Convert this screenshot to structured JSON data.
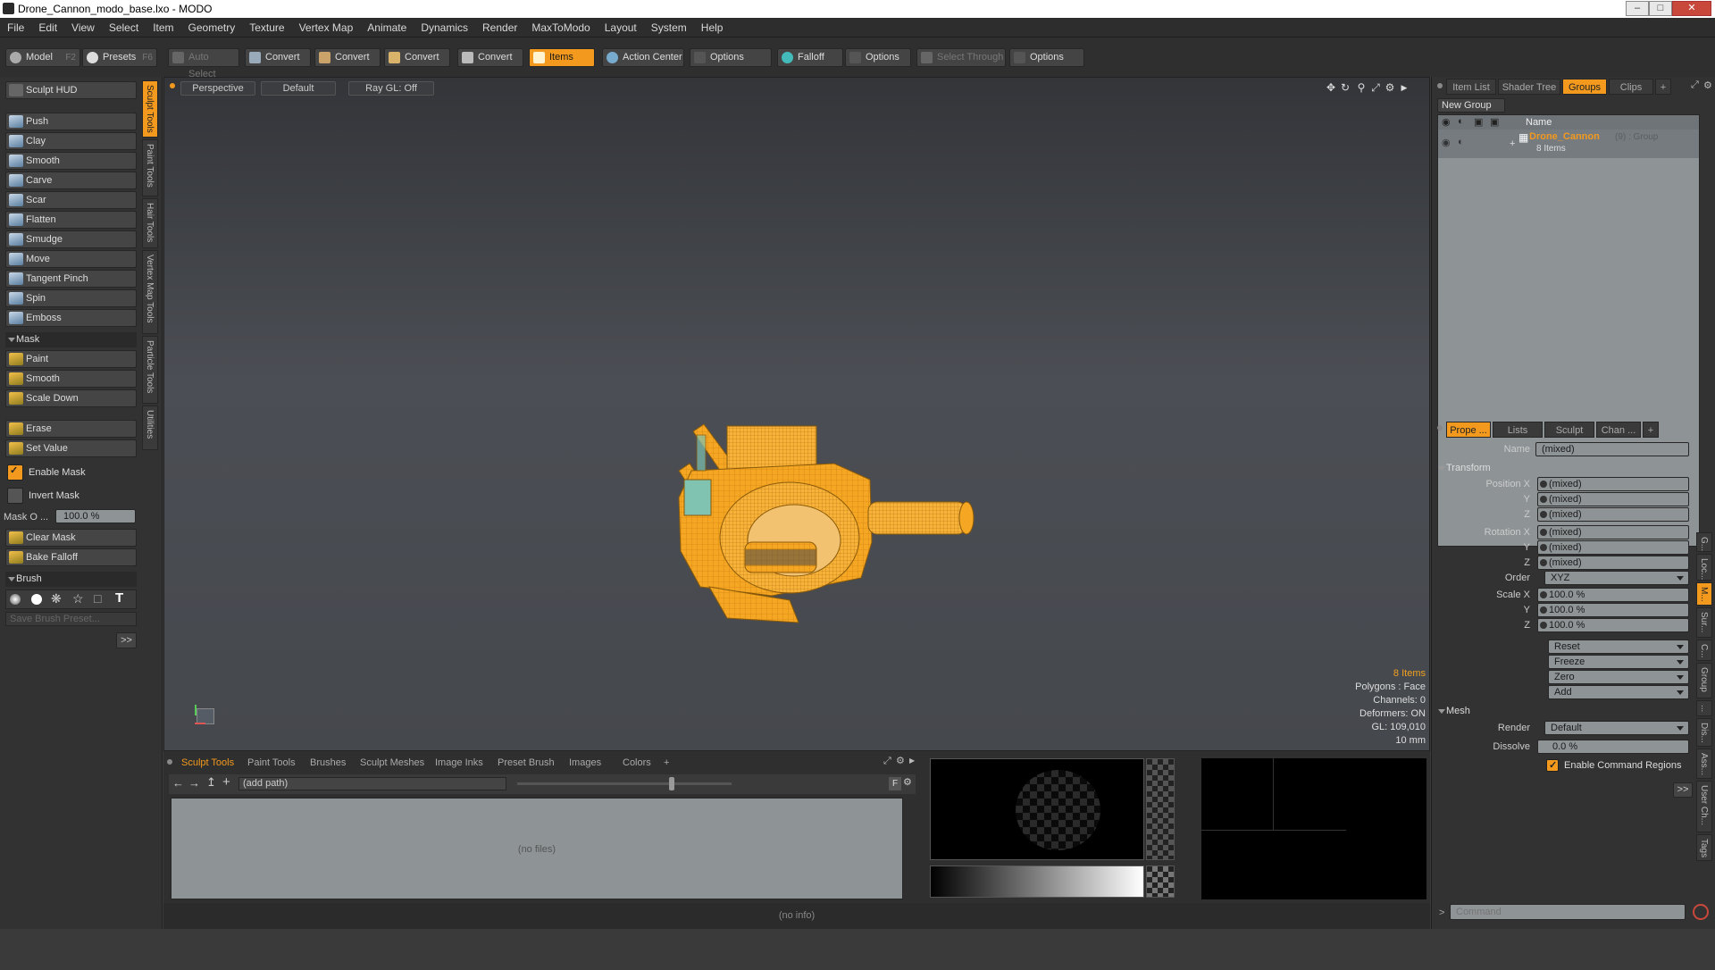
{
  "window": {
    "title": "Drone_Cannon_modo_base.lxo - MODO",
    "min": "–",
    "max": "□",
    "close": "✕"
  },
  "menu": [
    "File",
    "Edit",
    "View",
    "Select",
    "Item",
    "Geometry",
    "Texture",
    "Vertex Map",
    "Animate",
    "Dynamics",
    "Render",
    "MaxToModo",
    "Layout",
    "System",
    "Help"
  ],
  "toolbar": {
    "model": "Model",
    "model_key": "F2",
    "presets": "Presets",
    "presets_key": "F6",
    "auto_select": "Auto Select",
    "convert1": "Convert",
    "convert2": "Convert",
    "convert3": "Convert",
    "convert4": "Convert",
    "items": "Items",
    "action_center": "Action Center",
    "options1": "Options",
    "falloff": "Falloff",
    "options2": "Options",
    "select_through": "Select Through",
    "options3": "Options"
  },
  "left": {
    "hud": "Sculpt HUD",
    "tools": [
      "Push",
      "Clay",
      "Smooth",
      "Carve",
      "Scar",
      "Flatten",
      "Smudge",
      "Move",
      "Tangent Pinch",
      "Spin",
      "Emboss"
    ],
    "mask_head": "Mask",
    "mask_tools": [
      "Paint",
      "Smooth",
      "Scale Down"
    ],
    "erase": "Erase",
    "set_value": "Set Value",
    "enable_mask": "Enable Mask",
    "invert_mask": "Invert Mask",
    "mask_opacity_label": "Mask O ...",
    "mask_opacity_value": "100.0 %",
    "clear_mask": "Clear Mask",
    "bake_falloff": "Bake Falloff",
    "brush_head": "Brush",
    "save_brush": "Save Brush Preset...",
    "more": ">>",
    "vtabs": [
      "Sculpt Tools",
      "Paint Tools",
      "Hair Tools",
      "Vertex Map Tools",
      "Particle Tools",
      "Utilities"
    ]
  },
  "viewport": {
    "tabs": [
      "Perspective",
      "Default",
      "Ray GL: Off"
    ],
    "stats": {
      "items": "8 Items",
      "polygons": "Polygons : Face",
      "channels": "Channels: 0",
      "deformers": "Deformers: ON",
      "gl": "GL: 109,010",
      "scale": "10 mm"
    }
  },
  "bottom": {
    "tabs": [
      "Sculpt Tools",
      "Paint Tools",
      "Brushes",
      "Sculpt Meshes",
      "Image Inks",
      "Preset Brush",
      "Images",
      "Colors",
      "+"
    ],
    "path": "(add path)",
    "no_files": "(no files)",
    "f_btn": "F"
  },
  "status": "(no info)",
  "right": {
    "tabs": [
      "Item List",
      "Shader Tree",
      "Groups",
      "Clips",
      "+"
    ],
    "new_group": "New Group",
    "col_name": "Name",
    "group_name": "Drone_Cannon",
    "group_meta": "(9) : Group",
    "group_items": "8 Items",
    "prop_tabs": [
      "Prope ...",
      "Lists",
      "Sculpt",
      "Chan ...",
      "+"
    ],
    "name_label": "Name",
    "name_value": "(mixed)",
    "transform_head": "Transform",
    "pos_label": "Position X",
    "rot_label": "Rotation X",
    "scale_label": "Scale X",
    "y_label": "Y",
    "z_label": "Z",
    "mixed": "(mixed)",
    "order_label": "Order",
    "order_value": "XYZ",
    "scale_value": "100.0 %",
    "reset": "Reset",
    "freeze": "Freeze",
    "zero": "Zero",
    "add": "Add",
    "mesh_head": "Mesh",
    "render_label": "Render",
    "render_value": "Default",
    "dissolve_label": "Dissolve",
    "dissolve_value": "0.0 %",
    "enable_cmd": "Enable Command Regions",
    "more": ">>",
    "command_placeholder": "Command",
    "side_tabs": [
      "G...",
      "Loc...",
      "M...",
      "Sur...",
      "C...",
      "Group",
      "...",
      "Dis...",
      "Ass...",
      "User Ch...",
      "Tags"
    ]
  },
  "colors": {
    "accent": "#f39a1e",
    "mesh": "#f5a623"
  }
}
